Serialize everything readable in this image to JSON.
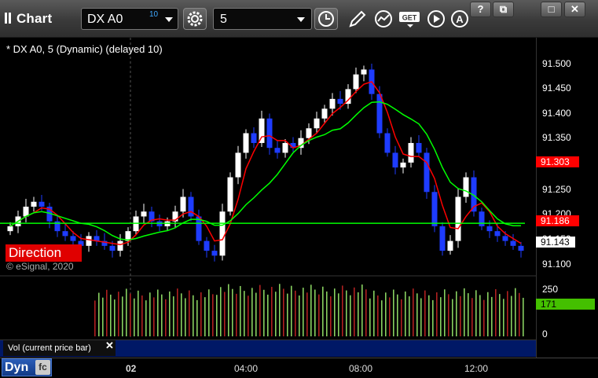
{
  "toolbar": {
    "title": "Chart",
    "symbol": "DX A0",
    "symbol_superscript": "10",
    "interval": "5",
    "icons": [
      "settings-icon",
      "clock-icon",
      "pencil-icon",
      "chart-style-icon",
      "get-icon",
      "play-icon",
      "a-icon"
    ],
    "window_buttons": [
      "?",
      "⧉",
      "□",
      "✕"
    ]
  },
  "chart": {
    "title": "* DX A0, 5 (Dynamic) (delayed 10)",
    "watermark": "© eSignal, 2020",
    "direction_label": "Direction",
    "price_ticks": [
      "91.500",
      "91.450",
      "91.400",
      "91.350",
      "91.300",
      "91.250",
      "91.200",
      "91.150",
      "91.100"
    ],
    "price_tags": [
      {
        "label": "91.303",
        "bg": "#ff0000",
        "color": "#ffffff"
      },
      {
        "label": "91.186",
        "bg": "#ff0000",
        "color": "#ffffff"
      },
      {
        "label": "91.143",
        "bg": "#ffffff",
        "color": "#000000"
      }
    ],
    "colors": {
      "up": "#ffffff",
      "down": "#1e3cff",
      "fast_ma": "#ff0000",
      "slow_ma": "#00ff00",
      "volume_up": "#88d060",
      "volume_down": "#b02020"
    }
  },
  "volume": {
    "label": "Vol (current price bar)",
    "ticks": [
      "250",
      "0"
    ],
    "current_value": "171",
    "current_bg": "#44c000"
  },
  "time_axis": {
    "ticks": [
      "02",
      "04:00",
      "08:00",
      "12:00"
    ],
    "dyn_label": "Dyn",
    "dyn_icon": "fc"
  },
  "chart_data": {
    "type": "candlestick",
    "title": "* DX A0, 5 (Dynamic) (delayed 10)",
    "ylim": [
      91.09,
      91.52
    ],
    "x_ticks": [
      "02",
      "04:00",
      "08:00",
      "12:00"
    ],
    "close_series": [
      91.18,
      91.2,
      91.22,
      91.23,
      91.22,
      91.19,
      91.17,
      91.16,
      91.15,
      91.14,
      91.16,
      91.15,
      91.14,
      91.13,
      91.15,
      91.17,
      91.2,
      91.21,
      91.19,
      91.18,
      91.19,
      91.21,
      91.24,
      91.2,
      91.15,
      91.13,
      91.12,
      91.21,
      91.28,
      91.33,
      91.37,
      91.35,
      91.4,
      91.34,
      91.33,
      91.35,
      91.34,
      91.36,
      91.38,
      91.4,
      91.42,
      91.44,
      91.43,
      91.46,
      91.49,
      91.5,
      91.45,
      91.37,
      91.33,
      91.3,
      91.31,
      91.35,
      91.33,
      91.25,
      91.18,
      91.13,
      91.15,
      91.24,
      91.28,
      91.21,
      91.18,
      91.17,
      91.16,
      91.15,
      91.14,
      91.13
    ],
    "series": [
      {
        "name": "fast_ma",
        "color": "#ff0000"
      },
      {
        "name": "slow_ma",
        "color": "#00ff00"
      }
    ],
    "volume_range": [
      0,
      250
    ]
  }
}
